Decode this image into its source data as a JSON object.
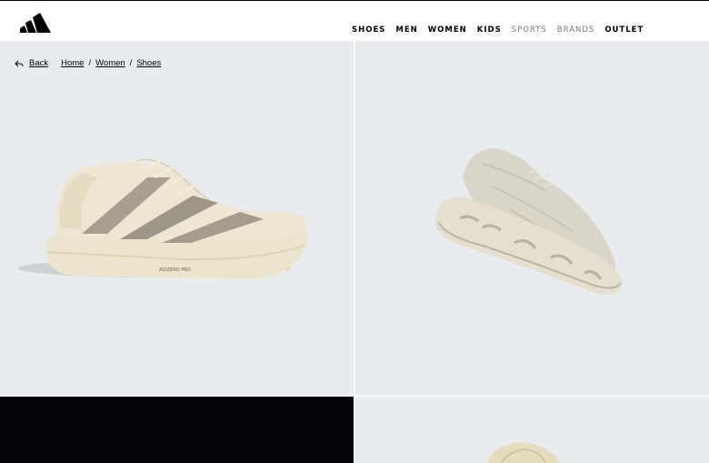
{
  "header": {
    "logo": "adidas-logo",
    "nav": [
      {
        "label": "SHOES",
        "muted": false
      },
      {
        "label": "MEN",
        "muted": false
      },
      {
        "label": "WOMEN",
        "muted": false
      },
      {
        "label": "KIDS",
        "muted": false
      },
      {
        "label": "SPORTS",
        "muted": true
      },
      {
        "label": "BRANDS",
        "muted": true
      },
      {
        "label": "OUTLET",
        "muted": false
      }
    ]
  },
  "breadcrumb": {
    "back_label": "Back",
    "items": [
      "Home",
      "Women",
      "Shoes"
    ],
    "separator": "/"
  },
  "gallery": {
    "background": "#e9ecee",
    "dark_tile": "#050509",
    "shoe_print": "ADIZERO PRO"
  }
}
